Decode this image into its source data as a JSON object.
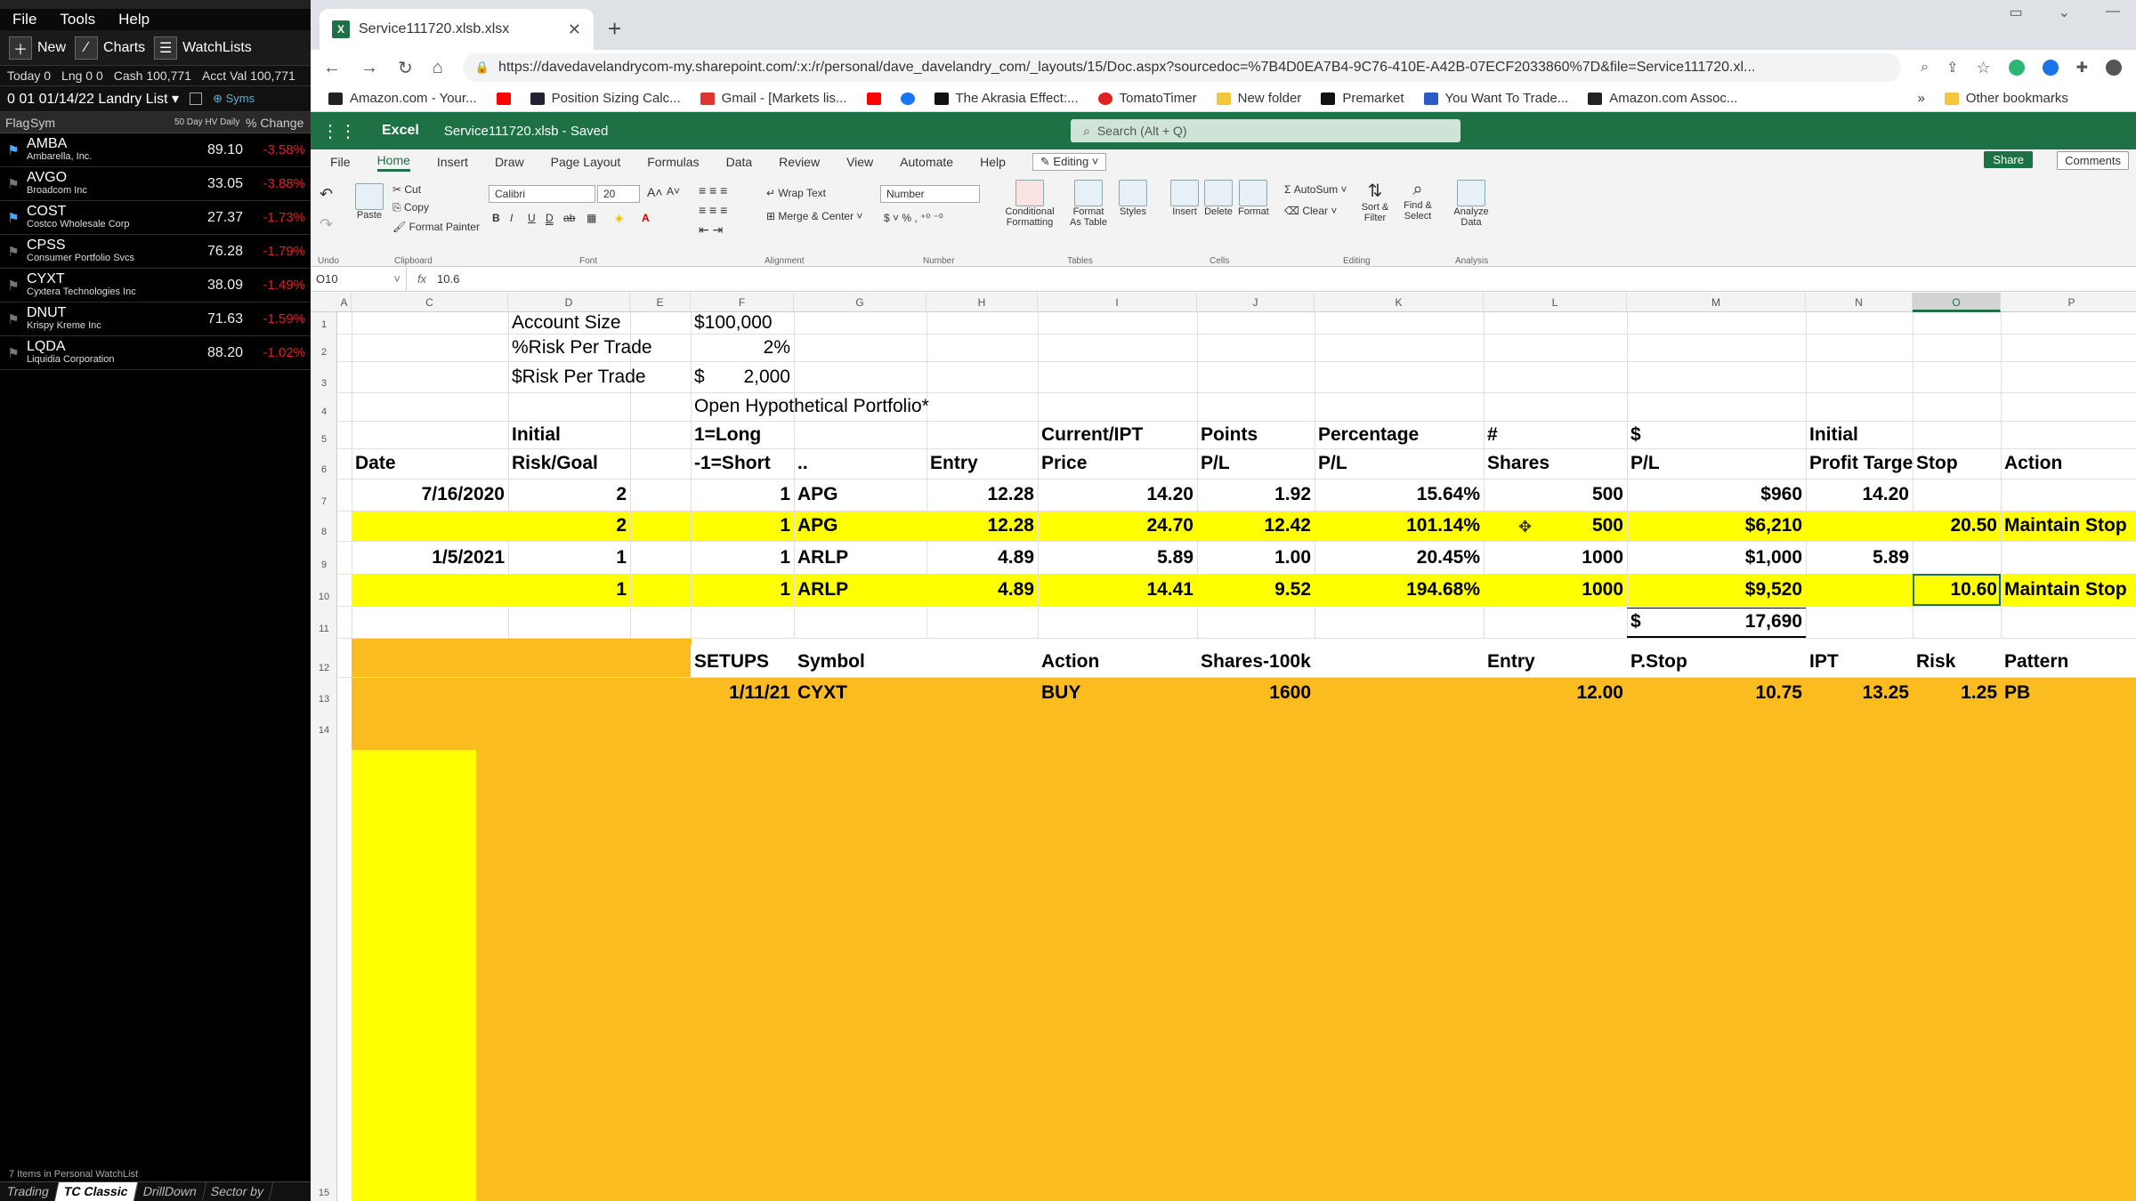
{
  "tc": {
    "menu": [
      "File",
      "Tools",
      "Help"
    ],
    "toolbar": {
      "new": "New",
      "charts": "Charts",
      "watchlists": "WatchLists"
    },
    "acct": {
      "today": "Today 0",
      "lng": "Lng 0 0",
      "cash": "Cash 100,771",
      "acctval": "Acct Val 100,771"
    },
    "list_name": "0 01 01/14/22 Landry List ▾",
    "syms_label": "Syms",
    "col_flag": "Flag",
    "col_sym": "Sym",
    "col_hv": "50 Day HV Daily",
    "col_change": "% Change",
    "rows": [
      {
        "sym": "AMBA",
        "name": "Ambarella, Inc.",
        "price": "89.10",
        "chg": "-3.58%",
        "flag_on": true
      },
      {
        "sym": "AVGO",
        "name": "Broadcom Inc",
        "price": "33.05",
        "chg": "-3.88%",
        "flag_on": false
      },
      {
        "sym": "COST",
        "name": "Costco Wholesale Corp",
        "price": "27.37",
        "chg": "-1.73%",
        "flag_on": true
      },
      {
        "sym": "CPSS",
        "name": "Consumer Portfolio Svcs",
        "price": "76.28",
        "chg": "-1.79%",
        "flag_on": false
      },
      {
        "sym": "CYXT",
        "name": "Cyxtera Technologies Inc",
        "price": "38.09",
        "chg": "-1.49%",
        "flag_on": false
      },
      {
        "sym": "DNUT",
        "name": "Krispy Kreme Inc",
        "price": "71.63",
        "chg": "-1.59%",
        "flag_on": false
      },
      {
        "sym": "LQDA",
        "name": "Liquidia Corporation",
        "price": "88.20",
        "chg": "-1.02%",
        "flag_on": false
      }
    ],
    "footer": "7 Items in Personal WatchList",
    "tabs": [
      "Trading",
      "TC Classic",
      "DrillDown",
      "Sector by"
    ]
  },
  "browser": {
    "tab_title": "Service111720.xlsb.xlsx",
    "url": "https://davedavelandrycom-my.sharepoint.com/:x:/r/personal/dave_davelandry_com/_layouts/15/Doc.aspx?sourcedoc=%7B4D0EA7B4-9C76-410E-A42B-07ECF2033860%7D&file=Service111720.xl...",
    "bookmarks": [
      "Amazon.com - Your...",
      "",
      "Position Sizing Calc...",
      "Gmail - [Markets lis...",
      "",
      "",
      "The Akrasia Effect:...",
      "TomatoTimer",
      "New folder",
      "Premarket",
      "You Want To Trade...",
      "Amazon.com Assoc..."
    ],
    "other_bookmarks": "Other bookmarks"
  },
  "excel": {
    "app": "Excel",
    "file": "Service111720.xlsb - Saved",
    "search": "Search (Alt + Q)",
    "ribbon_tabs": [
      "File",
      "Home",
      "Insert",
      "Draw",
      "Page Layout",
      "Formulas",
      "Data",
      "Review",
      "View",
      "Automate",
      "Help"
    ],
    "editing": "Editing",
    "share": "Share",
    "comments": "Comments",
    "ribbon": {
      "undo": "Undo",
      "paste": "Paste",
      "cut": "Cut",
      "copy": "Copy",
      "format_painter": "Format Painter",
      "clipboard": "Clipboard",
      "font_name": "Calibri",
      "font_size": "20",
      "font": "Font",
      "wrap": "Wrap Text",
      "merge": "Merge & Center",
      "alignment": "Alignment",
      "number_format": "Number",
      "number": "Number",
      "cond": "Conditional Formatting",
      "fmt_table": "Format As Table",
      "styles": "Styles",
      "tables": "Tables",
      "insert": "Insert",
      "delete": "Delete",
      "format": "Format",
      "cells": "Cells",
      "autosum": "AutoSum",
      "clear": "Clear",
      "sort": "Sort & Filter",
      "find": "Find & Select",
      "editing_group": "Editing",
      "analyze": "Analyze Data",
      "analysis": "Analysis"
    },
    "name_box": "O10",
    "formula": "10.6",
    "columns": [
      "A",
      "C",
      "D",
      "E",
      "F",
      "G",
      "H",
      "I",
      "J",
      "K",
      "L",
      "M",
      "N",
      "O",
      "P"
    ],
    "rows": [
      "1",
      "2",
      "3",
      "4",
      "5",
      "6",
      "7",
      "8",
      "9",
      "10",
      "11",
      "12",
      "13",
      "14",
      "15"
    ],
    "cells": {
      "d1": "Account Size",
      "f1": "$100,000",
      "d2": "%Risk Per Trade",
      "f2": "2%",
      "d3": "$Risk Per Trade",
      "f3a": "$",
      "f3b": "2,000",
      "f4": "Open Hypothetical Portfolio*",
      "d5": "Initial",
      "f5": "1=Long",
      "i5": "Current/IPT",
      "j5": "Points",
      "k5": "Percentage",
      "l5": "#",
      "m5": "$",
      "n5": "Initial",
      "c6": "Date",
      "d6": "Risk/Goal",
      "f6": "-1=Short",
      "g6": "..",
      "h6": "Entry",
      "i6": "Price",
      "j6": "P/L",
      "k6": "P/L",
      "l6": "Shares",
      "m6": "P/L",
      "n6": "Profit Targe",
      "o6": "Stop",
      "p6": "Action",
      "c7": "7/16/2020",
      "d7": "2",
      "f7": "1",
      "g7": "APG",
      "h7": "12.28",
      "i7": "14.20",
      "j7": "1.92",
      "k7": "15.64%",
      "l7": "500",
      "m7": "$960",
      "n7": "14.20",
      "d8": "2",
      "f8": "1",
      "g8": "APG",
      "h8": "12.28",
      "i8": "24.70",
      "j8": "12.42",
      "k8": "101.14%",
      "l8": "500",
      "m8": "$6,210",
      "o8": "20.50",
      "p8": "Maintain Stop",
      "c9": "1/5/2021",
      "d9": "1",
      "f9": "1",
      "g9": "ARLP",
      "h9": "4.89",
      "i9": "5.89",
      "j9": "1.00",
      "k9": "20.45%",
      "l9": "1000",
      "m9": "$1,000",
      "n9": "5.89",
      "d10": "1",
      "f10": "1",
      "g10": "ARLP",
      "h10": "4.89",
      "i10": "14.41",
      "j10": "9.52",
      "k10": "194.68%",
      "l10": "1000",
      "m10": "$9,520",
      "o10": "10.60",
      "p10": "Maintain Stop",
      "m11a": "$",
      "m11b": "17,690",
      "f12": "SETUPS",
      "g12": "Symbol",
      "i12": "Action",
      "j12": "Shares-100k",
      "l12": "Entry",
      "m12": "P.Stop",
      "n12": "IPT",
      "o12": "Risk",
      "p12": "Pattern",
      "f13": "1/11/21",
      "g13": "CYXT",
      "i13": "BUY",
      "j13": "1600",
      "l13": "12.00",
      "m13": "10.75",
      "n13": "13.25",
      "o13": "1.25",
      "p13": "PB"
    }
  },
  "colors": {
    "yellow": "#ffff00",
    "orange": "#fbbc1f",
    "excel_green": "#1e7145",
    "neg_red": "#e02020"
  }
}
